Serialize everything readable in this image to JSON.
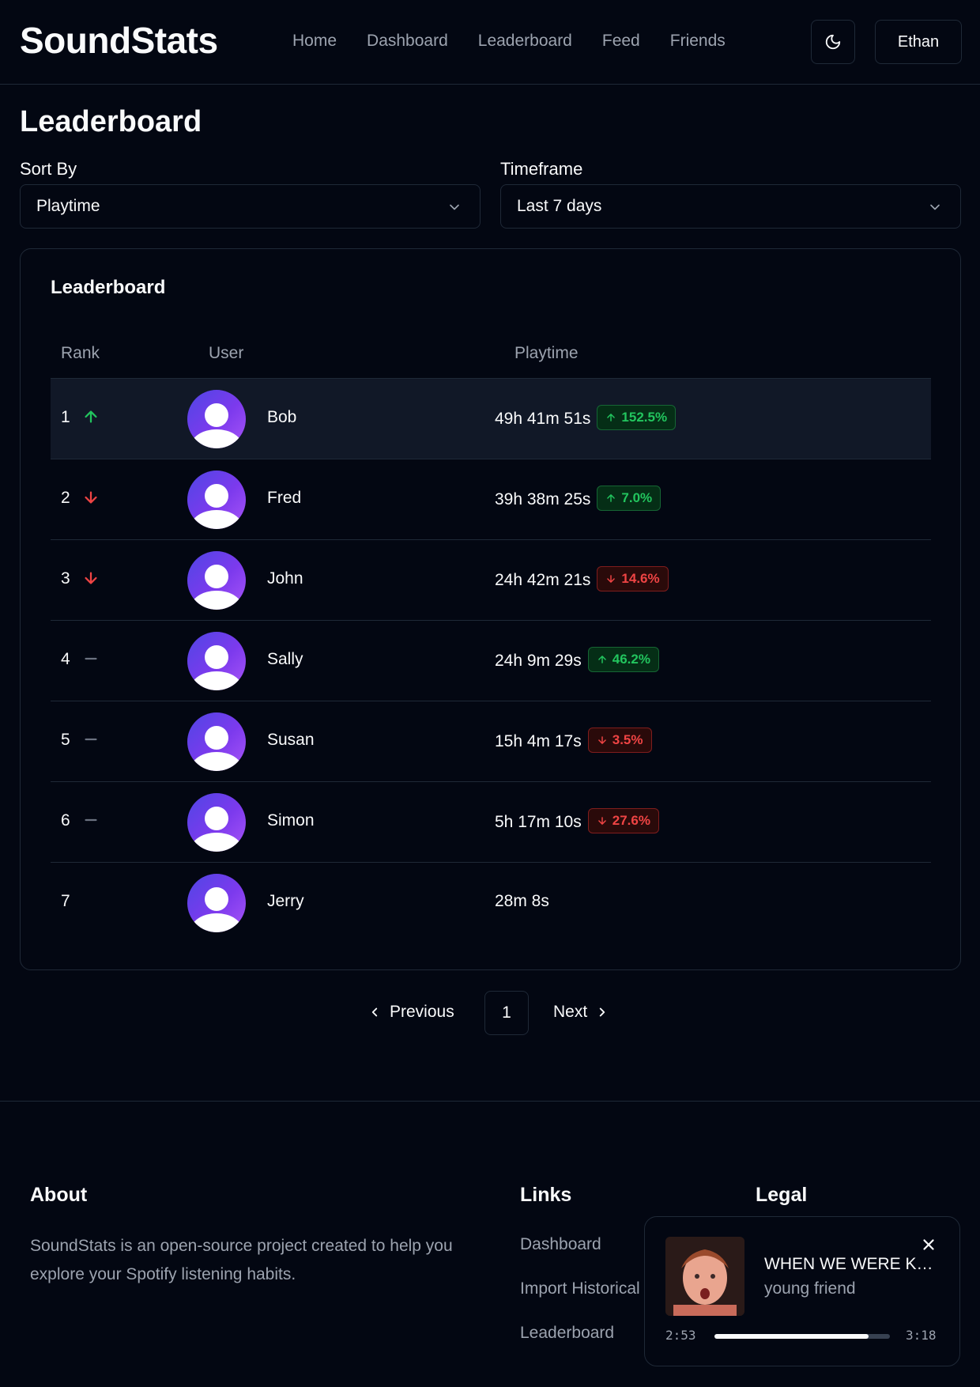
{
  "header": {
    "logo": "SoundStats",
    "nav": [
      "Home",
      "Dashboard",
      "Leaderboard",
      "Feed",
      "Friends"
    ],
    "theme_icon": "moon-icon",
    "user_button": "Ethan"
  },
  "page": {
    "title": "Leaderboard",
    "sort_label": "Sort By",
    "sort_value": "Playtime",
    "timeframe_label": "Timeframe",
    "timeframe_value": "Last 7 days"
  },
  "card": {
    "title": "Leaderboard",
    "columns": [
      "Rank",
      "User",
      "Playtime"
    ],
    "rows": [
      {
        "rank": "1",
        "trend": "up",
        "name": "Bob",
        "playtime": "49h 41m 51s",
        "change": "152.5%",
        "change_dir": "up"
      },
      {
        "rank": "2",
        "trend": "down",
        "name": "Fred",
        "playtime": "39h 38m 25s",
        "change": "7.0%",
        "change_dir": "up"
      },
      {
        "rank": "3",
        "trend": "down",
        "name": "John",
        "playtime": "24h 42m 21s",
        "change": "14.6%",
        "change_dir": "down"
      },
      {
        "rank": "4",
        "trend": "same",
        "name": "Sally",
        "playtime": "24h 9m 29s",
        "change": "46.2%",
        "change_dir": "up"
      },
      {
        "rank": "5",
        "trend": "same",
        "name": "Susan",
        "playtime": "15h 4m 17s",
        "change": "3.5%",
        "change_dir": "down"
      },
      {
        "rank": "6",
        "trend": "same",
        "name": "Simon",
        "playtime": "5h 17m 10s",
        "change": "27.6%",
        "change_dir": "down"
      },
      {
        "rank": "7",
        "trend": "none",
        "name": "Jerry",
        "playtime": "28m 8s",
        "change": "",
        "change_dir": "none"
      }
    ],
    "colors": {
      "up": "#22c55e",
      "down": "#ef4444",
      "same": "#6b7280"
    }
  },
  "pagination": {
    "previous": "Previous",
    "page": "1",
    "next": "Next"
  },
  "footer": {
    "about_title": "About",
    "about_text": "SoundStats is an open-source project created to help you explore your Spotify listening habits.",
    "links_title": "Links",
    "links": [
      "Dashboard",
      "Import Historical Data",
      "Leaderboard"
    ],
    "legal_title": "Legal"
  },
  "player": {
    "title": "WHEN WE WERE KIDS",
    "artist": "young friend",
    "current": "2:53",
    "total": "3:18",
    "progress": 0.877
  }
}
